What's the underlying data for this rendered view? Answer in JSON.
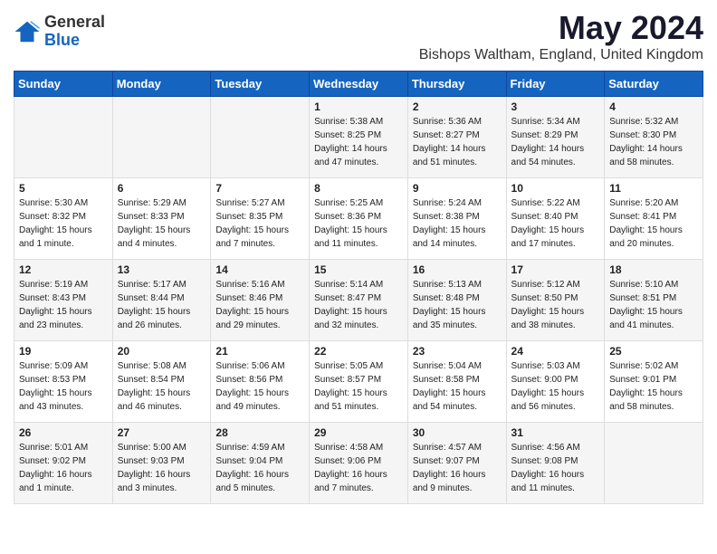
{
  "header": {
    "logo_general": "General",
    "logo_blue": "Blue",
    "month_title": "May 2024",
    "location": "Bishops Waltham, England, United Kingdom"
  },
  "days_of_week": [
    "Sunday",
    "Monday",
    "Tuesday",
    "Wednesday",
    "Thursday",
    "Friday",
    "Saturday"
  ],
  "weeks": [
    [
      {
        "day": "",
        "info": ""
      },
      {
        "day": "",
        "info": ""
      },
      {
        "day": "",
        "info": ""
      },
      {
        "day": "1",
        "info": "Sunrise: 5:38 AM\nSunset: 8:25 PM\nDaylight: 14 hours\nand 47 minutes."
      },
      {
        "day": "2",
        "info": "Sunrise: 5:36 AM\nSunset: 8:27 PM\nDaylight: 14 hours\nand 51 minutes."
      },
      {
        "day": "3",
        "info": "Sunrise: 5:34 AM\nSunset: 8:29 PM\nDaylight: 14 hours\nand 54 minutes."
      },
      {
        "day": "4",
        "info": "Sunrise: 5:32 AM\nSunset: 8:30 PM\nDaylight: 14 hours\nand 58 minutes."
      }
    ],
    [
      {
        "day": "5",
        "info": "Sunrise: 5:30 AM\nSunset: 8:32 PM\nDaylight: 15 hours\nand 1 minute."
      },
      {
        "day": "6",
        "info": "Sunrise: 5:29 AM\nSunset: 8:33 PM\nDaylight: 15 hours\nand 4 minutes."
      },
      {
        "day": "7",
        "info": "Sunrise: 5:27 AM\nSunset: 8:35 PM\nDaylight: 15 hours\nand 7 minutes."
      },
      {
        "day": "8",
        "info": "Sunrise: 5:25 AM\nSunset: 8:36 PM\nDaylight: 15 hours\nand 11 minutes."
      },
      {
        "day": "9",
        "info": "Sunrise: 5:24 AM\nSunset: 8:38 PM\nDaylight: 15 hours\nand 14 minutes."
      },
      {
        "day": "10",
        "info": "Sunrise: 5:22 AM\nSunset: 8:40 PM\nDaylight: 15 hours\nand 17 minutes."
      },
      {
        "day": "11",
        "info": "Sunrise: 5:20 AM\nSunset: 8:41 PM\nDaylight: 15 hours\nand 20 minutes."
      }
    ],
    [
      {
        "day": "12",
        "info": "Sunrise: 5:19 AM\nSunset: 8:43 PM\nDaylight: 15 hours\nand 23 minutes."
      },
      {
        "day": "13",
        "info": "Sunrise: 5:17 AM\nSunset: 8:44 PM\nDaylight: 15 hours\nand 26 minutes."
      },
      {
        "day": "14",
        "info": "Sunrise: 5:16 AM\nSunset: 8:46 PM\nDaylight: 15 hours\nand 29 minutes."
      },
      {
        "day": "15",
        "info": "Sunrise: 5:14 AM\nSunset: 8:47 PM\nDaylight: 15 hours\nand 32 minutes."
      },
      {
        "day": "16",
        "info": "Sunrise: 5:13 AM\nSunset: 8:48 PM\nDaylight: 15 hours\nand 35 minutes."
      },
      {
        "day": "17",
        "info": "Sunrise: 5:12 AM\nSunset: 8:50 PM\nDaylight: 15 hours\nand 38 minutes."
      },
      {
        "day": "18",
        "info": "Sunrise: 5:10 AM\nSunset: 8:51 PM\nDaylight: 15 hours\nand 41 minutes."
      }
    ],
    [
      {
        "day": "19",
        "info": "Sunrise: 5:09 AM\nSunset: 8:53 PM\nDaylight: 15 hours\nand 43 minutes."
      },
      {
        "day": "20",
        "info": "Sunrise: 5:08 AM\nSunset: 8:54 PM\nDaylight: 15 hours\nand 46 minutes."
      },
      {
        "day": "21",
        "info": "Sunrise: 5:06 AM\nSunset: 8:56 PM\nDaylight: 15 hours\nand 49 minutes."
      },
      {
        "day": "22",
        "info": "Sunrise: 5:05 AM\nSunset: 8:57 PM\nDaylight: 15 hours\nand 51 minutes."
      },
      {
        "day": "23",
        "info": "Sunrise: 5:04 AM\nSunset: 8:58 PM\nDaylight: 15 hours\nand 54 minutes."
      },
      {
        "day": "24",
        "info": "Sunrise: 5:03 AM\nSunset: 9:00 PM\nDaylight: 15 hours\nand 56 minutes."
      },
      {
        "day": "25",
        "info": "Sunrise: 5:02 AM\nSunset: 9:01 PM\nDaylight: 15 hours\nand 58 minutes."
      }
    ],
    [
      {
        "day": "26",
        "info": "Sunrise: 5:01 AM\nSunset: 9:02 PM\nDaylight: 16 hours\nand 1 minute."
      },
      {
        "day": "27",
        "info": "Sunrise: 5:00 AM\nSunset: 9:03 PM\nDaylight: 16 hours\nand 3 minutes."
      },
      {
        "day": "28",
        "info": "Sunrise: 4:59 AM\nSunset: 9:04 PM\nDaylight: 16 hours\nand 5 minutes."
      },
      {
        "day": "29",
        "info": "Sunrise: 4:58 AM\nSunset: 9:06 PM\nDaylight: 16 hours\nand 7 minutes."
      },
      {
        "day": "30",
        "info": "Sunrise: 4:57 AM\nSunset: 9:07 PM\nDaylight: 16 hours\nand 9 minutes."
      },
      {
        "day": "31",
        "info": "Sunrise: 4:56 AM\nSunset: 9:08 PM\nDaylight: 16 hours\nand 11 minutes."
      },
      {
        "day": "",
        "info": ""
      }
    ]
  ]
}
